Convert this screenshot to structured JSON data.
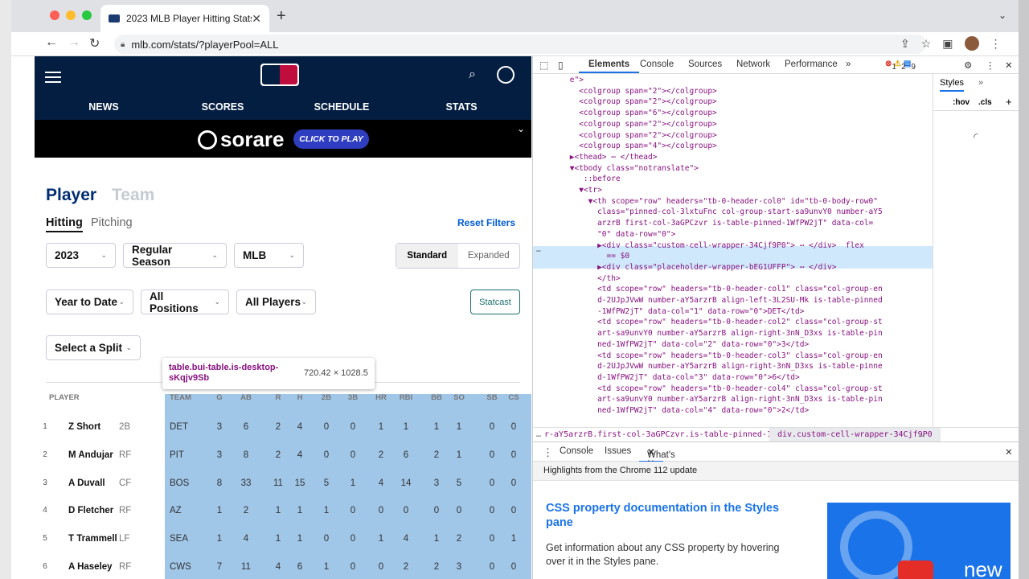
{
  "browser": {
    "tab_title": "2023 MLB Player Hitting Stats",
    "url": "mlb.com/stats/?playerPool=ALL"
  },
  "nav": {
    "links": [
      "NEWS",
      "SCORES",
      "SCHEDULE",
      "STATS"
    ]
  },
  "ad": {
    "brand": "sorare",
    "cta": "CLICK TO PLAY"
  },
  "tabs": {
    "player": "Player",
    "team": "Team",
    "hitting": "Hitting",
    "pitching": "Pitching",
    "reset": "Reset Filters"
  },
  "filters": {
    "year": "2023",
    "season": "Regular Season",
    "league": "MLB",
    "standard": "Standard",
    "expanded": "Expanded",
    "timeframe": "Year to Date",
    "positions": "All Positions",
    "players": "All Players",
    "statcast": "Statcast",
    "split": "Select a Split"
  },
  "tooltip": {
    "selector": "table.bui-table.is-desktop-sKqjv9Sb",
    "size": "720.42 × 1028.5"
  },
  "table": {
    "headers": [
      "PLAYER",
      "TEAM",
      "G",
      "AB",
      "R",
      "H",
      "2B",
      "3B",
      "HR",
      "RBI",
      "BB",
      "SO",
      "SB",
      "CS"
    ],
    "rows": [
      [
        "1",
        "Z Short",
        "2B",
        "DET",
        "3",
        "6",
        "2",
        "4",
        "0",
        "0",
        "1",
        "1",
        "1",
        "1",
        "0",
        "0"
      ],
      [
        "2",
        "M Andujar",
        "RF",
        "PIT",
        "3",
        "8",
        "2",
        "4",
        "0",
        "0",
        "2",
        "6",
        "2",
        "1",
        "0",
        "0"
      ],
      [
        "3",
        "A Duvall",
        "CF",
        "BOS",
        "8",
        "33",
        "11",
        "15",
        "5",
        "1",
        "4",
        "14",
        "3",
        "5",
        "0",
        "0"
      ],
      [
        "4",
        "D Fletcher",
        "RF",
        "AZ",
        "1",
        "2",
        "1",
        "1",
        "1",
        "0",
        "0",
        "0",
        "0",
        "0",
        "0",
        "0"
      ],
      [
        "5",
        "T Trammell",
        "LF",
        "SEA",
        "1",
        "4",
        "1",
        "1",
        "0",
        "0",
        "1",
        "4",
        "1",
        "2",
        "0",
        "1"
      ],
      [
        "6",
        "A Haseley",
        "RF",
        "CWS",
        "7",
        "11",
        "4",
        "6",
        "1",
        "0",
        "0",
        "2",
        "2",
        "3",
        "0",
        "0"
      ]
    ]
  },
  "devtools": {
    "tabs": [
      "Elements",
      "Console",
      "Sources",
      "Network",
      "Performance"
    ],
    "errors": "1",
    "warnings": "2",
    "messages": "9",
    "styles_tab": "Styles",
    "hov": ":hov",
    ".cls": ".cls",
    "lines": [
      "        e\">",
      "          <colgroup span=\"2\"></colgroup>",
      "          <colgroup span=\"2\"></colgroup>",
      "          <colgroup span=\"6\"></colgroup>",
      "          <colgroup span=\"2\"></colgroup>",
      "          <colgroup span=\"2\"></colgroup>",
      "          <colgroup span=\"4\"></colgroup>",
      "        ▶<thead> ⋯ </thead>",
      "        ▼<tbody class=\"notranslate\">",
      "           ::before",
      "          ▼<tr>",
      "            ▼<th scope=\"row\" headers=\"tb-0-header-col0\" id=\"tb-0-body-row0\"",
      "              class=\"pinned-col-3lxtuFnc col-group-start-sa9unvY0 number-aY5",
      "              arzrB first-col-3aGPCzvr is-table-pinned-1WfPW2jT\" data-col=",
      "              \"0\" data-row=\"0\">",
      "              ▶<div class=\"custom-cell-wrapper-34Cjf9P0\"> ⋯ </div>  flex",
      "                == $0",
      "              ▶<div class=\"placeholder-wrapper-bEG1UFFP\"> ⋯ </div>",
      "              </th>",
      "              <td scope=\"row\" headers=\"tb-0-header-col1\" class=\"col-group-en",
      "              d-2UJpJVwW number-aY5arzrB align-left-3L2SU-Mk is-table-pinned",
      "              -1WfPW2jT\" data-col=\"1\" data-row=\"0\">DET</td>",
      "              <td scope=\"row\" headers=\"tb-0-header-col2\" class=\"col-group-st",
      "              art-sa9unvY0 number-aY5arzrB align-right-3nN_D3xs is-table-pin",
      "              ned-1WfPW2jT\" data-col=\"2\" data-row=\"0\">3</td>",
      "              <td scope=\"row\" headers=\"tb-0-header-col3\" class=\"col-group-en",
      "              d-2UJpJVwW number-aY5arzrB align-right-3nN_D3xs is-table-pinne",
      "              d-1WfPW2jT\" data-col=\"3\" data-row=\"0\">6</td>",
      "              <td scope=\"row\" headers=\"tb-0-header-col4\" class=\"col-group-st",
      "              art-sa9unvY0 number-aY5arzrB align-right-3nN_D3xs is-table-pin",
      "              ned-1WfPW2jT\" data-col=\"4\" data-row=\"0\">2</td>"
    ],
    "crumb1": "r-aY5arzrB.first-col-3aGPCzvr.is-table-pinned-1WfPW2jT",
    "crumb2": "div.custom-cell-wrapper-34Cjf9P0",
    "drawer_tabs": [
      "Console",
      "Issues",
      "What's New"
    ],
    "whatsnew_header": "Highlights from the Chrome 112 update",
    "feature_title": "CSS property documentation in the Styles pane",
    "feature_desc": "Get information about any CSS property by hovering over it in the Styles pane.",
    "promo_word": "new"
  }
}
